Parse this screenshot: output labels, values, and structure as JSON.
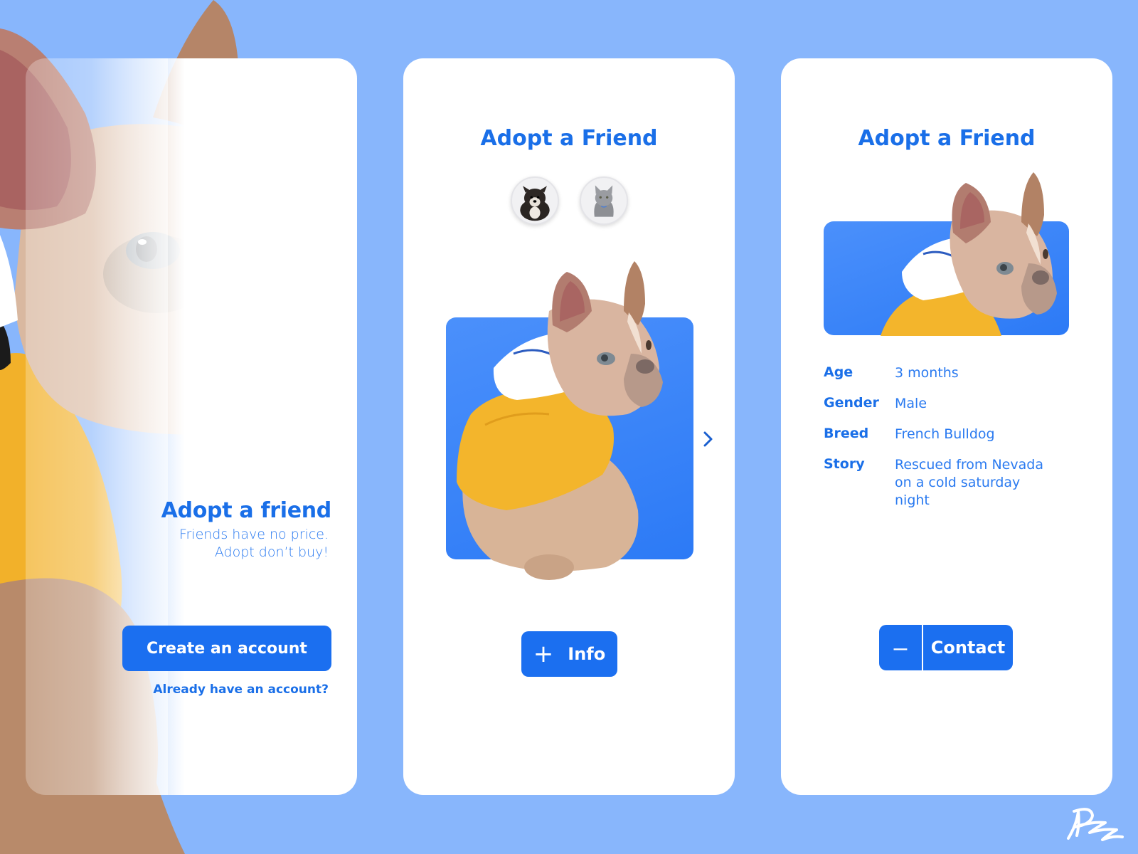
{
  "colors": {
    "background": "#88b6fc",
    "accent": "#1b6ff0",
    "card": "#ffffff",
    "panel": "#3a84f8",
    "hoodie": "#f2b12a"
  },
  "welcome": {
    "title": "Adopt a friend",
    "subtitle_line1": "Friends have no price.",
    "subtitle_line2": "Adopt don’t buy!",
    "create_account_label": "Create an account",
    "login_link": "Already have an account?"
  },
  "browse": {
    "title": "Adopt a Friend",
    "avatars": [
      {
        "label": "puppy",
        "icon": "puppy-avatar"
      },
      {
        "label": "cat",
        "icon": "cat-avatar"
      }
    ],
    "next_icon": "chevron-right-icon",
    "info_label": "Info",
    "info_icon": "plus-icon"
  },
  "detail": {
    "title": "Adopt a Friend",
    "fields": [
      {
        "key": "Age",
        "value": "3 months"
      },
      {
        "key": "Gender",
        "value": "Male"
      },
      {
        "key": "Breed",
        "value": "French Bulldog"
      },
      {
        "key": "Story",
        "value": "Rescued from Nevada on a cold saturday night"
      }
    ],
    "minus_icon": "minus-icon",
    "contact_label": "Contact"
  }
}
